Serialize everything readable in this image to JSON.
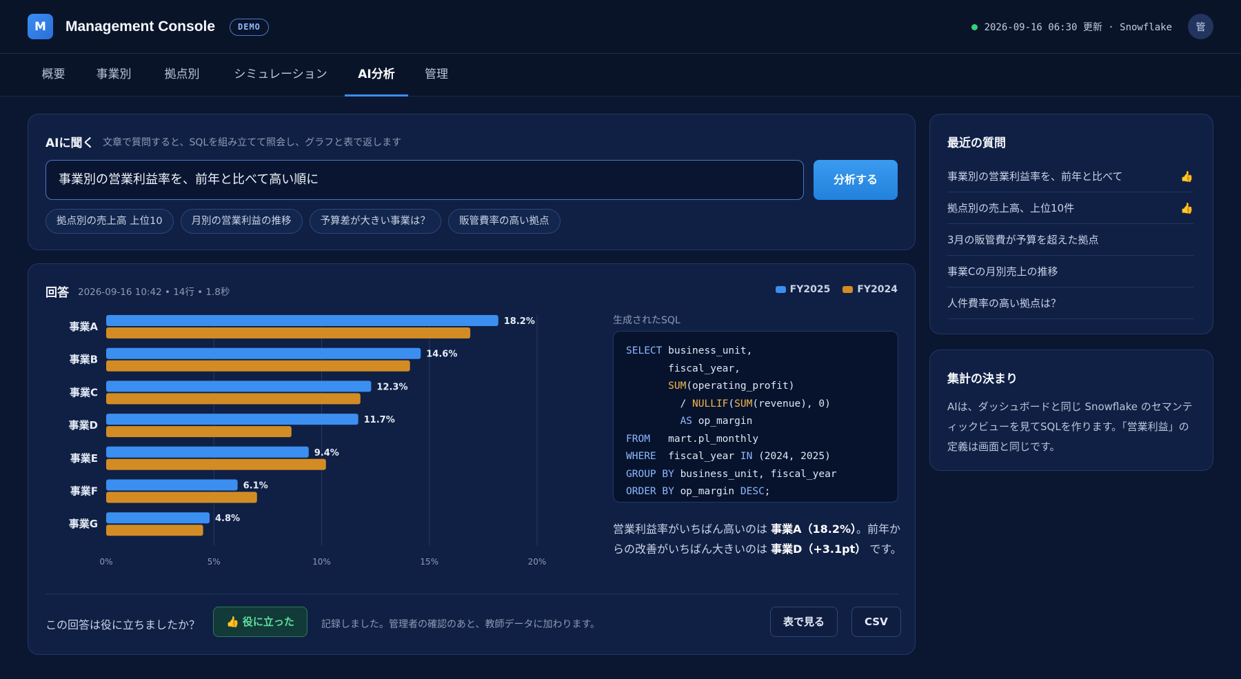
{
  "app": {
    "logo_letter": "M",
    "title": "Management Console",
    "badge": "DEMO",
    "status_text": "2026-09-16 06:30 更新 · Snowflake",
    "avatar_initial": "管"
  },
  "tabs": [
    {
      "label": "概要"
    },
    {
      "label": "事業別"
    },
    {
      "label": "拠点別"
    },
    {
      "label": "シミュレーション"
    },
    {
      "label": "AI分析",
      "active": true
    },
    {
      "label": "管理"
    }
  ],
  "ask": {
    "title": "AIに聞く",
    "subtitle": "文章で質問すると、SQLを組み立てて照会し、グラフと表で返します",
    "query_value": "事業別の営業利益率を、前年と比べて高い順に",
    "analyze_button": "分析する",
    "suggestions": [
      "拠点別の売上高 上位10",
      "月別の営業利益の推移",
      "予算差が大きい事業は？",
      "販管費率の高い拠点"
    ]
  },
  "answer": {
    "title": "回答",
    "meta": "2026-09-16 10:42 • 14行 • 1.8秒",
    "sql_label": "生成されたSQL",
    "summary_pre": "営業利益率がいちばん高いのは ",
    "summary_b1": "事業A（18.2%）",
    "summary_mid": "。前年からの改善がいちばん大きいのは ",
    "summary_b2": "事業D（+3.1pt）",
    "summary_post": " です。",
    "feedback_question": "この回答は役に立ちましたか？",
    "helpful_button": "👍 役に立った",
    "feedback_note": "記録しました。管理者の確認のあと、教師データに加わります。",
    "table_button": "表で見る",
    "csv_button": "CSV"
  },
  "chart_data": {
    "type": "bar",
    "orientation": "horizontal",
    "categories": [
      "事業A",
      "事業B",
      "事業C",
      "事業D",
      "事業E",
      "事業F",
      "事業G"
    ],
    "series": [
      {
        "name": "FY2025",
        "color": "#3b8ff0",
        "values": [
          18.2,
          14.6,
          12.3,
          11.7,
          9.4,
          6.1,
          4.8
        ]
      },
      {
        "name": "FY2024",
        "color": "#d38c24",
        "values": [
          16.9,
          14.1,
          11.8,
          8.6,
          10.2,
          7.0,
          4.5
        ]
      }
    ],
    "data_labels": [
      "18.2%",
      "14.6%",
      "12.3%",
      "11.7%",
      "9.4%",
      "6.1%",
      "4.8%"
    ],
    "x_ticks": [
      "0%",
      "5%",
      "10%",
      "15%",
      "20%"
    ],
    "xlim": [
      0,
      20
    ],
    "grid": true,
    "legend": "top-right"
  },
  "recent": {
    "title": "最近の質問",
    "items": [
      {
        "label": "事業別の営業利益率を、前年と比べて",
        "liked": true
      },
      {
        "label": "拠点別の売上高、上位10件",
        "liked": true
      },
      {
        "label": "3月の販管費が予算を超えた拠点",
        "liked": false
      },
      {
        "label": "事業Cの月別売上の推移",
        "liked": false
      },
      {
        "label": "人件費率の高い拠点は？",
        "liked": false
      }
    ],
    "thumb_icon": "👍"
  },
  "rules": {
    "title": "集計の決まり",
    "text": "AIは、ダッシュボードと同じ Snowflake のセマンティックビューを見てSQLを作ります。「営業利益」の定義は画面と同じです。"
  }
}
